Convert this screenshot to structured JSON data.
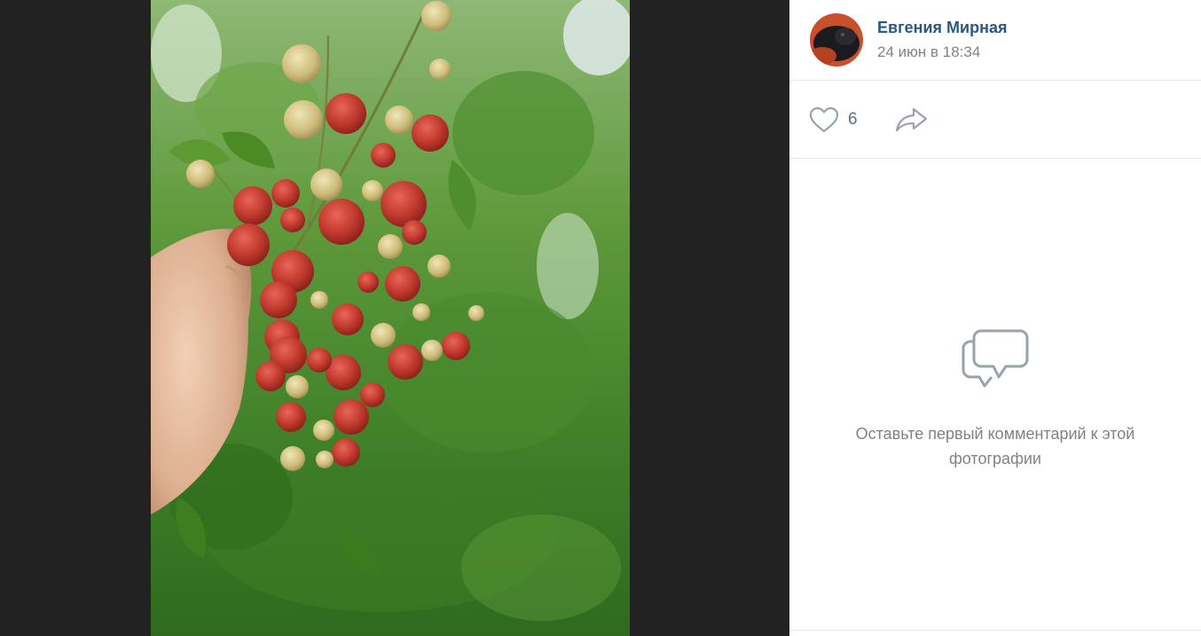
{
  "post": {
    "author": "Евгения Мирная",
    "date": "24 июн в 18:34"
  },
  "actions": {
    "likes": "6",
    "like_icon": "heart-outline-icon",
    "share_icon": "share-arrow-icon"
  },
  "comments": {
    "empty_icon": "comment-bubbles-icon",
    "empty_text": "Оставьте первый комментарий к этой фотографии"
  },
  "colors": {
    "author_link": "#2a5885",
    "secondary_text": "#828282",
    "icon": "#99a2ad",
    "viewer_bg": "#222222"
  }
}
